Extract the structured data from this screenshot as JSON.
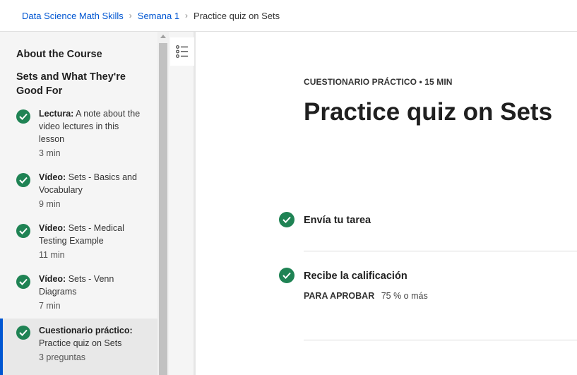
{
  "breadcrumb": {
    "course": "Data Science Math Skills",
    "week": "Semana 1",
    "current": "Practice quiz on Sets"
  },
  "sidebar": {
    "about": "About the Course",
    "module": "Sets and What They're Good For",
    "items": [
      {
        "type": "Lectura:",
        "title": "A note about the video lectures in this lesson",
        "duration": "3 min"
      },
      {
        "type": "Vídeo:",
        "title": "Sets - Basics and Vocabulary",
        "duration": "9 min"
      },
      {
        "type": "Vídeo:",
        "title": "Sets - Medical Testing Example",
        "duration": "11 min"
      },
      {
        "type": "Vídeo:",
        "title": "Sets - Venn Diagrams",
        "duration": "7 min"
      },
      {
        "type": "Cuestionario práctico:",
        "title": "Practice quiz on Sets",
        "duration": "3 preguntas"
      }
    ]
  },
  "main": {
    "eyebrow": "CUESTIONARIO PRÁCTICO • 15 MIN",
    "title": "Practice quiz on Sets",
    "step1": "Envía tu tarea",
    "step2": "Recibe la calificación",
    "pass_label": "PARA APROBAR",
    "pass_value": "75 % o más"
  },
  "colors": {
    "accent": "#0056d2",
    "success": "#1f8354"
  }
}
